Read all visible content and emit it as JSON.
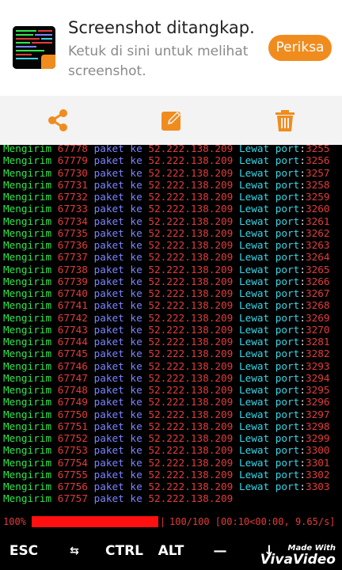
{
  "notification": {
    "title": "Screenshot ditangkap.",
    "body": "Ketuk di sini untuk melihat screenshot.",
    "action": "Periksa",
    "accent": "#f08c1e"
  },
  "action_bar": {
    "icons": [
      "share-icon",
      "edit-icon",
      "delete-icon"
    ]
  },
  "terminal": {
    "word_send": "Mengirim",
    "word_packet": "paket ke",
    "ip": "52.222.138.209",
    "word_port": "Lewat port",
    "lines": [
      {
        "num": "67778",
        "port": "3255"
      },
      {
        "num": "67779",
        "port": "3256"
      },
      {
        "num": "67730",
        "port": "3257"
      },
      {
        "num": "67731",
        "port": "3258"
      },
      {
        "num": "67732",
        "port": "3259"
      },
      {
        "num": "67733",
        "port": "3260"
      },
      {
        "num": "67734",
        "port": "3261"
      },
      {
        "num": "67735",
        "port": "3262"
      },
      {
        "num": "67736",
        "port": "3263"
      },
      {
        "num": "67737",
        "port": "3264"
      },
      {
        "num": "67738",
        "port": "3265"
      },
      {
        "num": "67739",
        "port": "3266"
      },
      {
        "num": "67740",
        "port": "3267"
      },
      {
        "num": "67741",
        "port": "3268"
      },
      {
        "num": "67742",
        "port": "3269"
      },
      {
        "num": "67743",
        "port": "3270"
      },
      {
        "num": "67744",
        "port": "3281"
      },
      {
        "num": "67745",
        "port": "3282"
      },
      {
        "num": "67746",
        "port": "3293"
      },
      {
        "num": "67747",
        "port": "3294"
      },
      {
        "num": "67748",
        "port": "3295"
      },
      {
        "num": "67749",
        "port": "3296"
      },
      {
        "num": "67750",
        "port": "3297"
      },
      {
        "num": "67751",
        "port": "3298"
      },
      {
        "num": "67752",
        "port": "3299"
      },
      {
        "num": "67753",
        "port": "3300"
      },
      {
        "num": "67754",
        "port": "3301"
      },
      {
        "num": "67755",
        "port": "3302"
      },
      {
        "num": "67756",
        "port": "3303"
      },
      {
        "num": "67757",
        "port": ""
      }
    ]
  },
  "progress": {
    "percent_label": "100%",
    "value": 1.0,
    "stats": "100/100 [00:10<00:00, 9.65/s]"
  },
  "extra_keys": {
    "esc": "ESC",
    "tab": "⇆",
    "ctrl": "CTRL",
    "alt": "ALT",
    "dash": "—",
    "down": "↓"
  },
  "watermark": {
    "small": "Made With",
    "big": "VivaVideo"
  }
}
